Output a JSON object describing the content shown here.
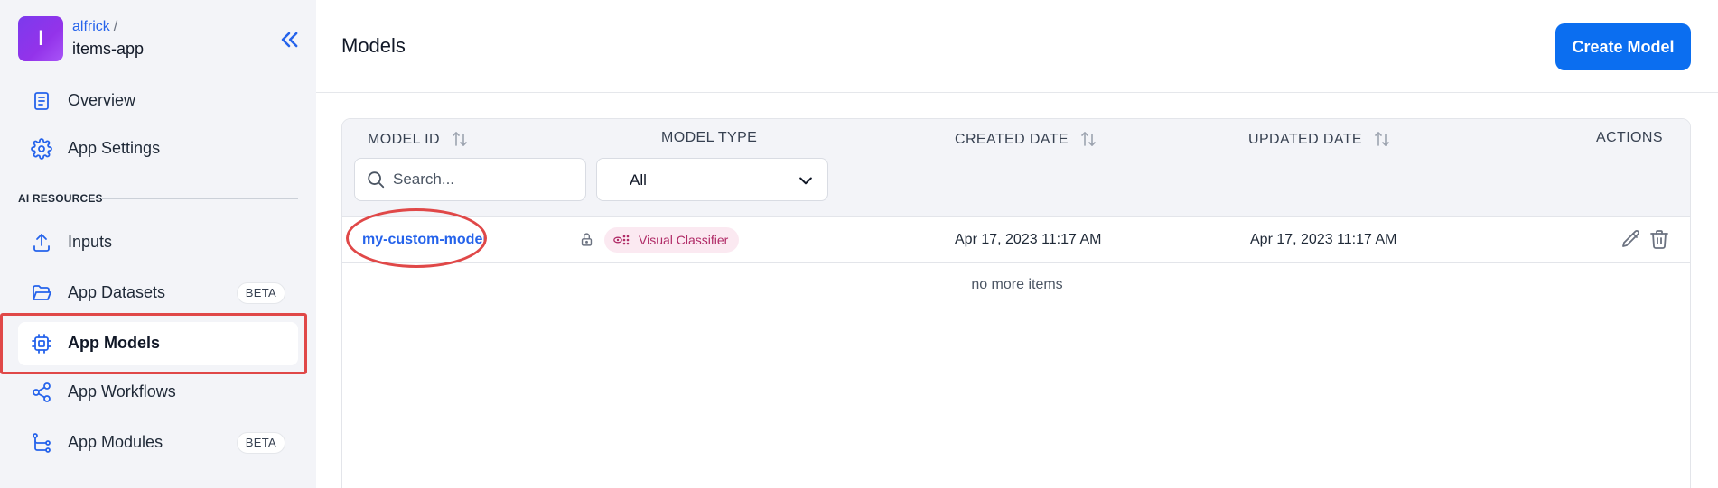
{
  "app": {
    "avatar_letter": "I",
    "owner": "alfrick",
    "separator": "/",
    "name": "items-app"
  },
  "sidebar": {
    "top_items": [
      {
        "label": "Overview",
        "icon": "document-icon"
      },
      {
        "label": "App Settings",
        "icon": "gear-icon"
      }
    ],
    "section_label": "AI RESOURCES",
    "resource_items": [
      {
        "label": "Inputs",
        "icon": "upload-icon"
      },
      {
        "label": "App Datasets",
        "icon": "folder-icon",
        "badge": "BETA"
      },
      {
        "label": "App Models",
        "icon": "chip-icon",
        "active": true
      },
      {
        "label": "App Workflows",
        "icon": "share-icon"
      },
      {
        "label": "App Modules",
        "icon": "flow-tree-icon",
        "badge": "BETA"
      }
    ]
  },
  "header": {
    "title": "Models",
    "create_button": "Create Model"
  },
  "table": {
    "columns": {
      "model_id": "MODEL ID",
      "model_type": "MODEL TYPE",
      "created_date": "CREATED DATE",
      "updated_date": "UPDATED DATE",
      "actions": "ACTIONS"
    },
    "search_placeholder": "Search...",
    "type_filter_value": "All",
    "rows": [
      {
        "model_id": "my-custom-model",
        "model_type": "Visual Classifier",
        "created": "Apr 17, 2023 11:17 AM",
        "updated": "Apr 17, 2023 11:17 AM"
      }
    ],
    "footer": "no more items"
  },
  "colors": {
    "accent": "#0b6ef0",
    "link": "#2563eb",
    "highlight": "#e04848",
    "badge_bg": "#fbe9f1",
    "badge_text": "#b02a66",
    "sidebar_bg": "#f3f4f8"
  }
}
